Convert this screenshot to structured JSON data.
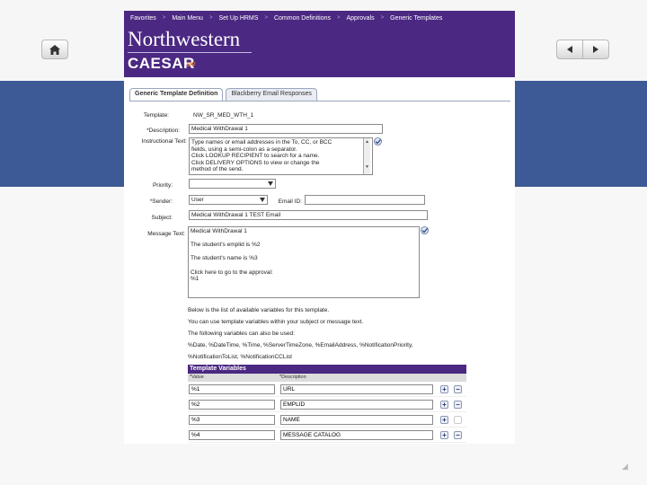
{
  "nav": {
    "items": [
      "Favorites",
      "Main Menu",
      "Set Up HRMS",
      "Common Definitions",
      "Approvals",
      "Generic Templates"
    ],
    "separator": ">"
  },
  "brand": {
    "name": "Northwestern",
    "app": "CAESAR",
    "app_suffix": "DV"
  },
  "tabs": [
    "Generic Template Definition",
    "Blackberry Email Responses"
  ],
  "form": {
    "template_label": "Template:",
    "template_value": "NW_SR_MED_WTH_1",
    "description_label": "*Description:",
    "description_value": "Medical WithDrawal 1",
    "instructional_label": "Instructional Text:",
    "instructional_lines": [
      "Type names or email addresses in the To, CC, or BCC",
      "fields, using a semi-colon as a separator.",
      "Click LOOKUP RECIPIENT to search for a name.",
      "Click DELIVERY OPTIONS to view or change the",
      "method of the send."
    ],
    "priority_label": "Priority:",
    "priority_value": "",
    "sender_label": "*Sender:",
    "sender_value": "User",
    "email_id_label": "Email ID:",
    "email_id_value": "",
    "subject_label": "Subject:",
    "subject_value": "Medical WithDrawal 1 TEST Email",
    "message_label": "Message Text:",
    "message_lines": [
      "Medical WithDrawal 1",
      "",
      "The student's emplid is %2",
      "",
      "The student's name is %3",
      "",
      "Click here to go to the approval:",
      "%1"
    ]
  },
  "info_lines": [
    "Below is the list of available variables for this template.",
    "You can use template variables within your subject or message text.",
    "The following variables can also be used:",
    "%Date, %DateTime, %Time, %ServerTimeZone, %EmailAddress, %NotificationPriority,",
    "%NotificationToList, %NotificationCCList"
  ],
  "grid": {
    "title": "Template Variables",
    "col_value": "*Value",
    "col_description": "*Description",
    "rows": [
      {
        "value": "%1",
        "description": "URL"
      },
      {
        "value": "%2",
        "description": "EMPLID"
      },
      {
        "value": "%3",
        "description": "NAME"
      },
      {
        "value": "%4",
        "description": "MESSAGE CATALOG"
      }
    ],
    "add_symbol": "+",
    "remove_symbol": "−"
  },
  "colors": {
    "brand_purple": "#4b2882",
    "slide_band": "#3e5a96"
  }
}
